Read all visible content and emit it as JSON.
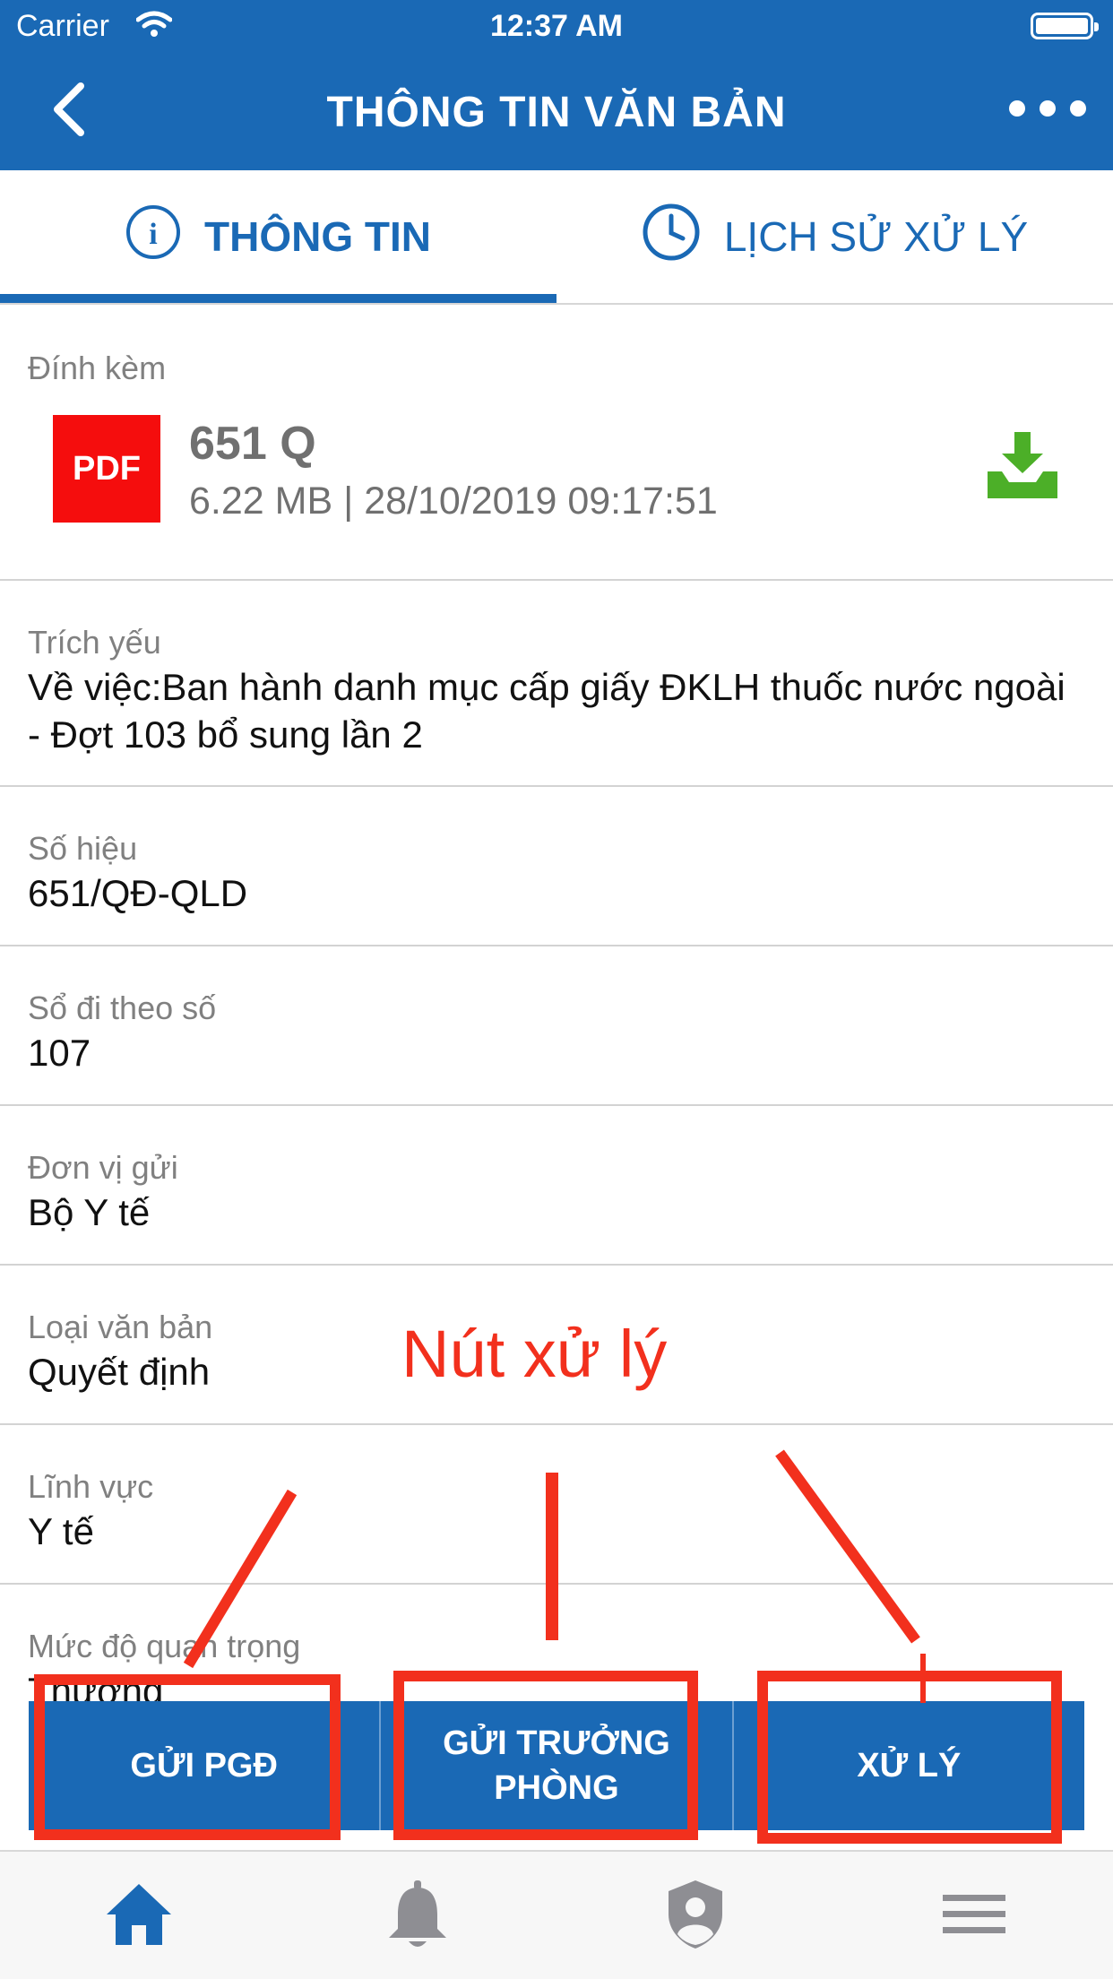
{
  "status_bar": {
    "carrier": "Carrier",
    "time": "12:37 AM"
  },
  "nav": {
    "title": "THÔNG TIN VĂN BẢN",
    "back_icon": "chevron-left-icon",
    "more_icon": "more-horizontal-icon"
  },
  "tabs": [
    {
      "label": "THÔNG TIN",
      "icon": "info-circle-icon",
      "active": true
    },
    {
      "label": "LỊCH SỬ XỬ LÝ",
      "icon": "clock-icon",
      "active": false
    }
  ],
  "attachment": {
    "label": "Đính kèm",
    "type_badge": "PDF",
    "name": "651 Q",
    "meta": "6.22 MB | 28/10/2019 09:17:51",
    "download_icon": "download-tray-icon"
  },
  "fields": [
    {
      "label": "Trích yếu",
      "value": "Về việc:Ban hành danh mục cấp giấy ĐKLH thuốc nước ngoài - Đợt 103 bổ sung lần 2"
    },
    {
      "label": "Số hiệu",
      "value": "651/QĐ-QLD"
    },
    {
      "label": "Sổ đi theo số",
      "value": "107"
    },
    {
      "label": "Đơn vị gửi",
      "value": "Bộ Y tế"
    },
    {
      "label": "Loại văn bản",
      "value": "Quyết định"
    },
    {
      "label": "Lĩnh vực",
      "value": "Y tế"
    },
    {
      "label": "Mức độ quan trọng",
      "value": "Thường"
    }
  ],
  "actions": [
    {
      "label": "GỬI PGĐ"
    },
    {
      "label": "GỬI TRƯỞNG PHÒNG"
    },
    {
      "label": "XỬ LÝ"
    }
  ],
  "annotation": {
    "text": "Nút xử lý",
    "color": "#f2301d"
  },
  "bottom_nav": [
    {
      "icon": "home-icon",
      "active": true
    },
    {
      "icon": "bell-icon",
      "active": false
    },
    {
      "icon": "shield-user-icon",
      "active": false
    },
    {
      "icon": "menu-icon",
      "active": false
    }
  ],
  "colors": {
    "primary": "#1a69b5",
    "pdf_red": "#f50d0d",
    "download_green": "#4caf28",
    "inactive_icon": "#8e8e93"
  }
}
